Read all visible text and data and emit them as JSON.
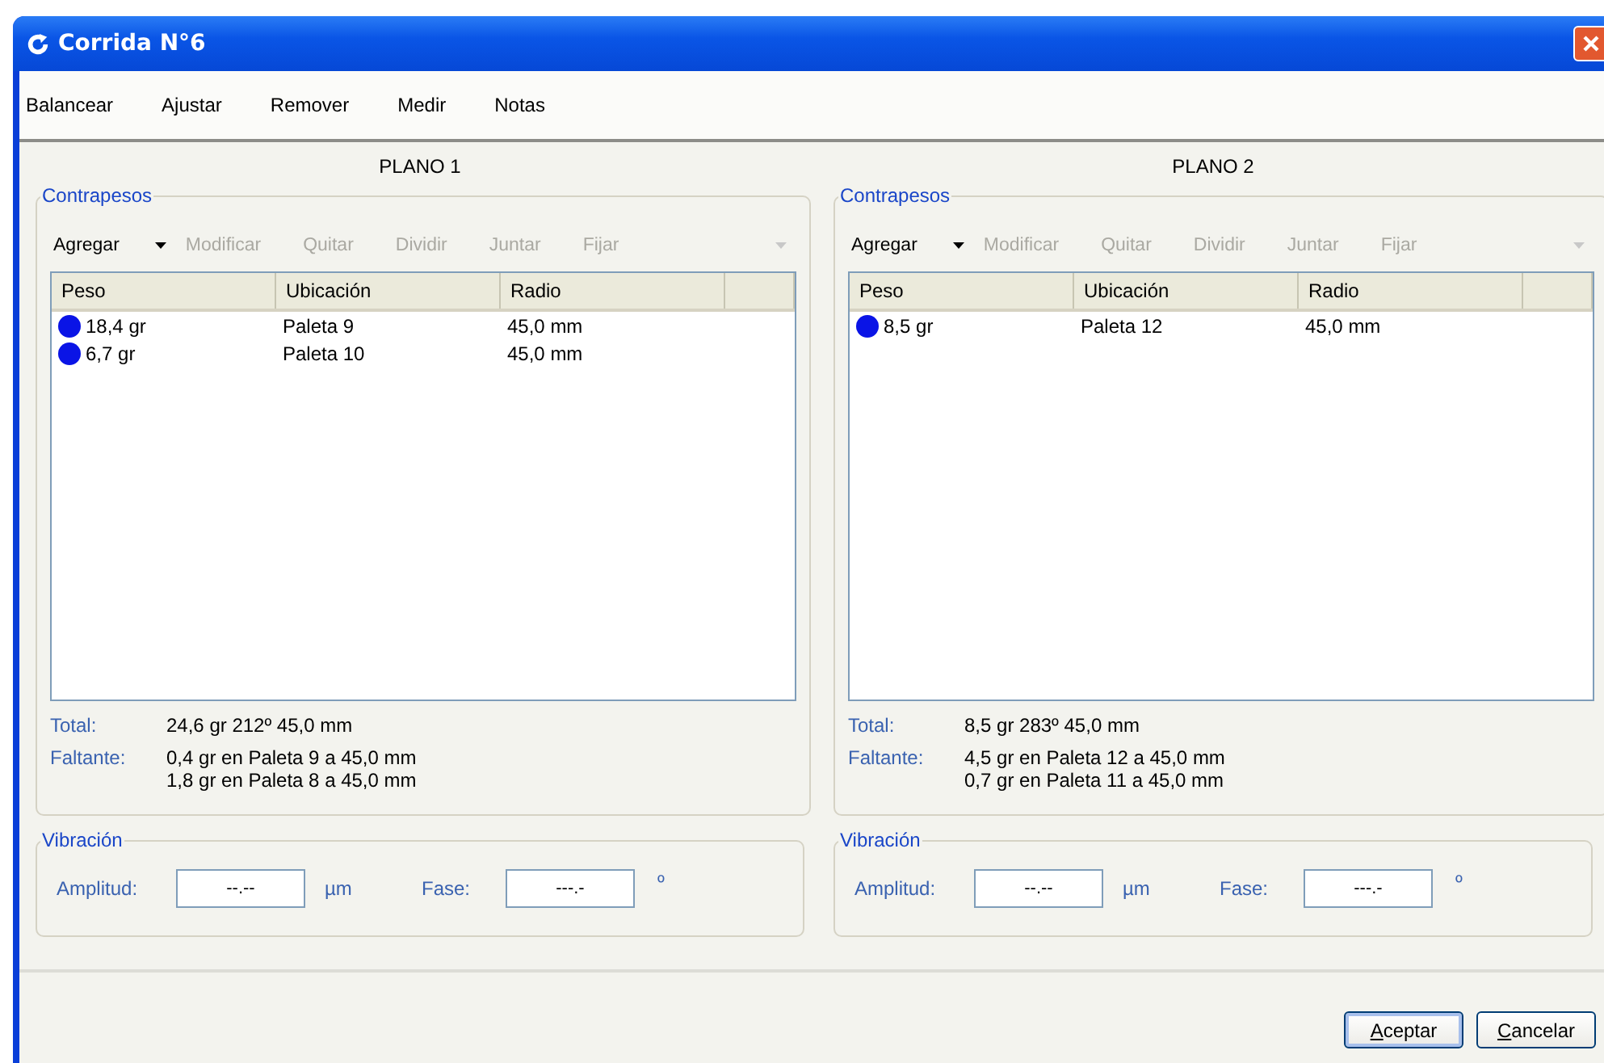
{
  "window": {
    "title": "Corrida N°6"
  },
  "menu": [
    "Balancear",
    "Ajustar",
    "Remover",
    "Medir",
    "Notas"
  ],
  "planes": [
    {
      "title": "PLANO 1",
      "group": "Contrapesos",
      "toolbar": [
        {
          "label": "Agregar",
          "disabled": false,
          "dropdown": true
        },
        {
          "label": "Modificar",
          "disabled": true,
          "dropdown": false
        },
        {
          "label": "Quitar",
          "disabled": true,
          "dropdown": false
        },
        {
          "label": "Dividir",
          "disabled": true,
          "dropdown": false
        },
        {
          "label": "Juntar",
          "disabled": true,
          "dropdown": false
        },
        {
          "label": "Fijar",
          "disabled": true,
          "dropdown": false
        }
      ],
      "overflow": {
        "disabled": true
      },
      "columns": [
        "Peso",
        "Ubicación",
        "Radio"
      ],
      "rows": [
        {
          "peso": "18,4 gr",
          "ubicacion": "Paleta 9",
          "radio": "45,0 mm"
        },
        {
          "peso": "6,7 gr",
          "ubicacion": "Paleta 10",
          "radio": "45,0 mm"
        }
      ],
      "total_label": "Total:",
      "total": "24,6 gr 212º 45,0 mm",
      "faltante_label": "Faltante:",
      "faltante": [
        "0,4 gr en Paleta 9 a 45,0 mm",
        "1,8 gr en Paleta 8 a 45,0 mm"
      ],
      "vibration": {
        "group": "Vibración",
        "amplitude_label": "Amplitud:",
        "amplitude": "--.--",
        "amplitude_unit": "µm",
        "phase_label": "Fase:",
        "phase": "---.-",
        "phase_unit": "º"
      }
    },
    {
      "title": "PLANO 2",
      "group": "Contrapesos",
      "toolbar": [
        {
          "label": "Agregar",
          "disabled": false,
          "dropdown": true
        },
        {
          "label": "Modificar",
          "disabled": true,
          "dropdown": false
        },
        {
          "label": "Quitar",
          "disabled": true,
          "dropdown": false
        },
        {
          "label": "Dividir",
          "disabled": true,
          "dropdown": false
        },
        {
          "label": "Juntar",
          "disabled": true,
          "dropdown": false
        },
        {
          "label": "Fijar",
          "disabled": true,
          "dropdown": false
        }
      ],
      "overflow": {
        "disabled": true
      },
      "columns": [
        "Peso",
        "Ubicación",
        "Radio"
      ],
      "rows": [
        {
          "peso": "8,5 gr",
          "ubicacion": "Paleta 12",
          "radio": "45,0 mm"
        }
      ],
      "total_label": "Total:",
      "total": "8,5 gr 283º 45,0 mm",
      "faltante_label": "Faltante:",
      "faltante": [
        "4,5 gr en Paleta 12 a 45,0 mm",
        "0,7 gr en Paleta 11 a 45,0 mm"
      ],
      "vibration": {
        "group": "Vibración",
        "amplitude_label": "Amplitud:",
        "amplitude": "--.--",
        "amplitude_unit": "µm",
        "phase_label": "Fase:",
        "phase": "---.-",
        "phase_unit": "º"
      }
    }
  ],
  "buttons": [
    {
      "label": "Aceptar",
      "default": true
    },
    {
      "label": "Cancelar",
      "default": false
    }
  ]
}
